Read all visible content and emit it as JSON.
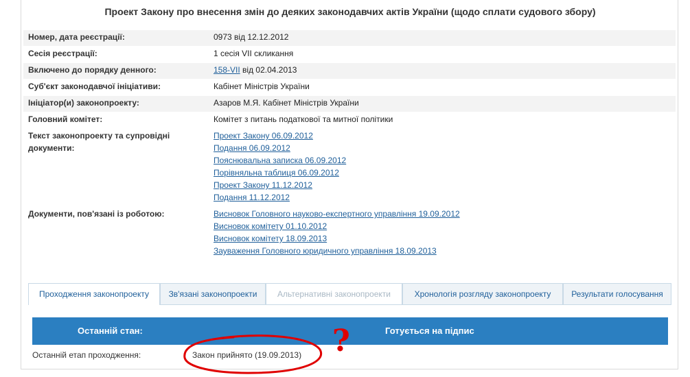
{
  "title": "Проект Закону про внесення змін до деяких законодавчих актів України (щодо сплати судового збору)",
  "fields": {
    "number_label": "Номер, дата реєстрації:",
    "number_value": "0973 від 12.12.2012",
    "session_label": "Сесія реєстрації:",
    "session_value": "1 сесія VII скликання",
    "agenda_label": "Включено до порядку денного:",
    "agenda_link": "158-VII",
    "agenda_suffix": "від 02.04.2013",
    "subject_label": "Суб'єкт законодавчої ініціативи:",
    "subject_value": "Кабінет Міністрів України",
    "initiator_label": "Ініціатор(и) законопроекту:",
    "initiator_value": "Азаров М.Я. Кабінет Міністрів України",
    "committee_label": "Головний комітет:",
    "committee_value": "Комітет з питань податкової та митної політики",
    "texts_label_line1": "Текст законопроекту та супровідні",
    "texts_label_line2": "документи:",
    "related_label": "Документи, пов'язані із роботою:"
  },
  "text_docs": [
    "Проект Закону 06.09.2012",
    "Подання 06.09.2012",
    "Пояснювальна записка 06.09.2012",
    "Порівняльна таблиця 06.09.2012",
    "Проект Закону 11.12.2012",
    "Подання 11.12.2012"
  ],
  "related_docs": [
    "Висновок Головного науково-експертного управління 19.09.2012",
    "Висновок комітету 01.10.2012",
    "Висновок комітету 18.09.2013",
    "Зауваження Головного юридичного управління 18.09.2013"
  ],
  "tabs": [
    {
      "label": "Проходження законопроекту",
      "state": "active"
    },
    {
      "label": "Зв'язані законопроекти",
      "state": "normal"
    },
    {
      "label": "Альтернативні законопроекти",
      "state": "disabled"
    },
    {
      "label": "Хронологія розгляду законопроекту",
      "state": "normal"
    },
    {
      "label": "Результати голосування",
      "state": "normal"
    }
  ],
  "status": {
    "last_state_label": "Останній стан:",
    "last_state_value": "Готується на підпис",
    "last_stage_label": "Останній етап проходження:",
    "last_stage_value": "Закон прийнято (19.09.2013)"
  },
  "annotation": {
    "mark": "?",
    "color": "#e00000"
  }
}
